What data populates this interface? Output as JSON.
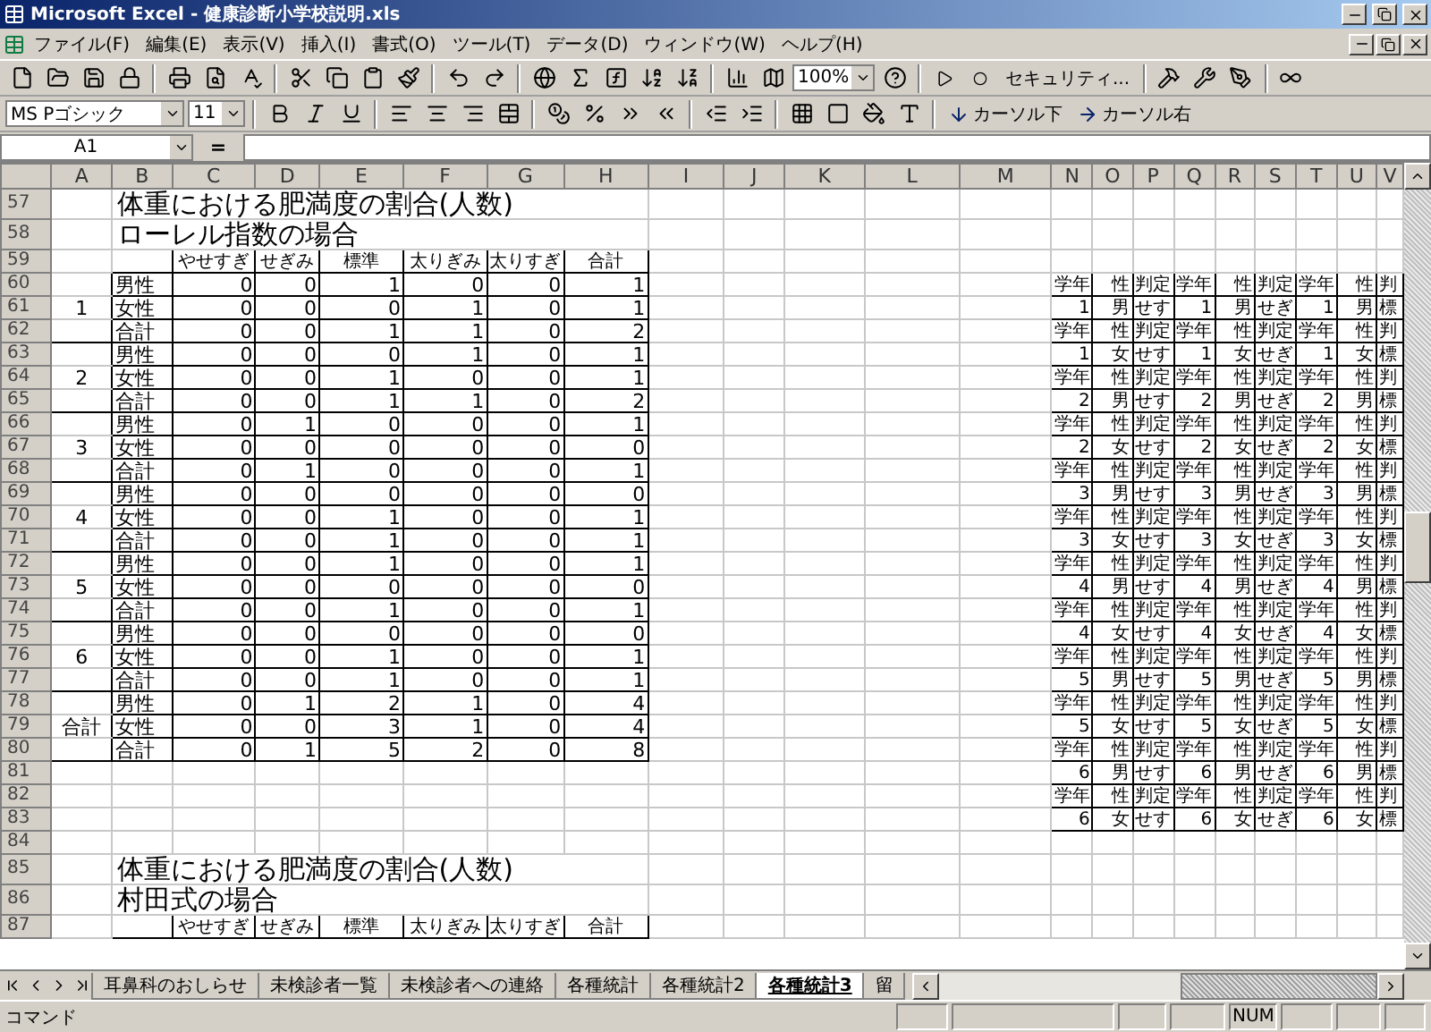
{
  "window": {
    "title": "Microsoft Excel - 健康診断小学校説明.xls"
  },
  "menu": [
    "ファイル(F)",
    "編集(E)",
    "表示(V)",
    "挿入(I)",
    "書式(O)",
    "ツール(T)",
    "データ(D)",
    "ウィンドウ(W)",
    "ヘルプ(H)"
  ],
  "toolbar": {
    "zoom": "100%",
    "security": "セキュリティ...",
    "font": "MS Pゴシック",
    "size": "11",
    "cursor_down": "カーソル下",
    "cursor_right": "カーソル右"
  },
  "formula_bar": {
    "name_box": "A1",
    "equals": "="
  },
  "columns": [
    "A",
    "B",
    "C",
    "D",
    "E",
    "F",
    "G",
    "H",
    "I",
    "J",
    "K",
    "L",
    "M",
    "N",
    "O",
    "P",
    "Q",
    "R",
    "S",
    "T",
    "U",
    "V"
  ],
  "rows": [
    {
      "num": "57",
      "kind": "title",
      "cells": {
        "B": "体重における肥満度の割合(人数)"
      }
    },
    {
      "num": "58",
      "kind": "title",
      "cells": {
        "B": "ローレル指数の場合"
      }
    },
    {
      "num": "59",
      "kind": "header",
      "cells": {
        "C": "やせすぎ",
        "D": "せぎみ",
        "E": "標準",
        "F": "太りぎみ",
        "G": "太りすぎ",
        "H": "合計"
      }
    },
    {
      "num": "60",
      "kind": "data",
      "cells": {
        "B": "男性",
        "C": "0",
        "D": "0",
        "E": "1",
        "F": "0",
        "G": "0",
        "H": "1",
        "N": "学年",
        "O": "性",
        "P": "判定",
        "Q": "学年",
        "R": "性",
        "S": "判定",
        "T": "学年",
        "U": "性",
        "V": "判"
      }
    },
    {
      "num": "61",
      "kind": "data",
      "cells": {
        "A": "1",
        "B": "女性",
        "C": "0",
        "D": "0",
        "E": "0",
        "F": "1",
        "G": "0",
        "H": "1",
        "N": "1",
        "O": "男",
        "P": "せす",
        "Q": "1",
        "R": "男",
        "S": "せぎ",
        "T": "1",
        "U": "男",
        "V": "標"
      }
    },
    {
      "num": "62",
      "kind": "data",
      "cells": {
        "B": "合計",
        "C": "0",
        "D": "0",
        "E": "1",
        "F": "1",
        "G": "0",
        "H": "2",
        "N": "学年",
        "O": "性",
        "P": "判定",
        "Q": "学年",
        "R": "性",
        "S": "判定",
        "T": "学年",
        "U": "性",
        "V": "判"
      }
    },
    {
      "num": "63",
      "kind": "data",
      "cells": {
        "B": "男性",
        "C": "0",
        "D": "0",
        "E": "0",
        "F": "1",
        "G": "0",
        "H": "1",
        "N": "1",
        "O": "女",
        "P": "せす",
        "Q": "1",
        "R": "女",
        "S": "せぎ",
        "T": "1",
        "U": "女",
        "V": "標"
      }
    },
    {
      "num": "64",
      "kind": "data",
      "cells": {
        "A": "2",
        "B": "女性",
        "C": "0",
        "D": "0",
        "E": "1",
        "F": "0",
        "G": "0",
        "H": "1",
        "N": "学年",
        "O": "性",
        "P": "判定",
        "Q": "学年",
        "R": "性",
        "S": "判定",
        "T": "学年",
        "U": "性",
        "V": "判"
      }
    },
    {
      "num": "65",
      "kind": "data",
      "cells": {
        "B": "合計",
        "C": "0",
        "D": "0",
        "E": "1",
        "F": "1",
        "G": "0",
        "H": "2",
        "N": "2",
        "O": "男",
        "P": "せす",
        "Q": "2",
        "R": "男",
        "S": "せぎ",
        "T": "2",
        "U": "男",
        "V": "標"
      }
    },
    {
      "num": "66",
      "kind": "data",
      "cells": {
        "B": "男性",
        "C": "0",
        "D": "1",
        "E": "0",
        "F": "0",
        "G": "0",
        "H": "1",
        "N": "学年",
        "O": "性",
        "P": "判定",
        "Q": "学年",
        "R": "性",
        "S": "判定",
        "T": "学年",
        "U": "性",
        "V": "判"
      }
    },
    {
      "num": "67",
      "kind": "data",
      "cells": {
        "A": "3",
        "B": "女性",
        "C": "0",
        "D": "0",
        "E": "0",
        "F": "0",
        "G": "0",
        "H": "0",
        "N": "2",
        "O": "女",
        "P": "せす",
        "Q": "2",
        "R": "女",
        "S": "せぎ",
        "T": "2",
        "U": "女",
        "V": "標"
      }
    },
    {
      "num": "68",
      "kind": "data",
      "cells": {
        "B": "合計",
        "C": "0",
        "D": "1",
        "E": "0",
        "F": "0",
        "G": "0",
        "H": "1",
        "N": "学年",
        "O": "性",
        "P": "判定",
        "Q": "学年",
        "R": "性",
        "S": "判定",
        "T": "学年",
        "U": "性",
        "V": "判"
      }
    },
    {
      "num": "69",
      "kind": "data",
      "cells": {
        "B": "男性",
        "C": "0",
        "D": "0",
        "E": "0",
        "F": "0",
        "G": "0",
        "H": "0",
        "N": "3",
        "O": "男",
        "P": "せす",
        "Q": "3",
        "R": "男",
        "S": "せぎ",
        "T": "3",
        "U": "男",
        "V": "標"
      }
    },
    {
      "num": "70",
      "kind": "data",
      "cells": {
        "A": "4",
        "B": "女性",
        "C": "0",
        "D": "0",
        "E": "1",
        "F": "0",
        "G": "0",
        "H": "1",
        "N": "学年",
        "O": "性",
        "P": "判定",
        "Q": "学年",
        "R": "性",
        "S": "判定",
        "T": "学年",
        "U": "性",
        "V": "判"
      }
    },
    {
      "num": "71",
      "kind": "data",
      "cells": {
        "B": "合計",
        "C": "0",
        "D": "0",
        "E": "1",
        "F": "0",
        "G": "0",
        "H": "1",
        "N": "3",
        "O": "女",
        "P": "せす",
        "Q": "3",
        "R": "女",
        "S": "せぎ",
        "T": "3",
        "U": "女",
        "V": "標"
      }
    },
    {
      "num": "72",
      "kind": "data",
      "cells": {
        "B": "男性",
        "C": "0",
        "D": "0",
        "E": "1",
        "F": "0",
        "G": "0",
        "H": "1",
        "N": "学年",
        "O": "性",
        "P": "判定",
        "Q": "学年",
        "R": "性",
        "S": "判定",
        "T": "学年",
        "U": "性",
        "V": "判"
      }
    },
    {
      "num": "73",
      "kind": "data",
      "cells": {
        "A": "5",
        "B": "女性",
        "C": "0",
        "D": "0",
        "E": "0",
        "F": "0",
        "G": "0",
        "H": "0",
        "N": "4",
        "O": "男",
        "P": "せす",
        "Q": "4",
        "R": "男",
        "S": "せぎ",
        "T": "4",
        "U": "男",
        "V": "標"
      }
    },
    {
      "num": "74",
      "kind": "data",
      "cells": {
        "B": "合計",
        "C": "0",
        "D": "0",
        "E": "1",
        "F": "0",
        "G": "0",
        "H": "1",
        "N": "学年",
        "O": "性",
        "P": "判定",
        "Q": "学年",
        "R": "性",
        "S": "判定",
        "T": "学年",
        "U": "性",
        "V": "判"
      }
    },
    {
      "num": "75",
      "kind": "data",
      "cells": {
        "B": "男性",
        "C": "0",
        "D": "0",
        "E": "0",
        "F": "0",
        "G": "0",
        "H": "0",
        "N": "4",
        "O": "女",
        "P": "せす",
        "Q": "4",
        "R": "女",
        "S": "せぎ",
        "T": "4",
        "U": "女",
        "V": "標"
      }
    },
    {
      "num": "76",
      "kind": "data",
      "cells": {
        "A": "6",
        "B": "女性",
        "C": "0",
        "D": "0",
        "E": "1",
        "F": "0",
        "G": "0",
        "H": "1",
        "N": "学年",
        "O": "性",
        "P": "判定",
        "Q": "学年",
        "R": "性",
        "S": "判定",
        "T": "学年",
        "U": "性",
        "V": "判"
      }
    },
    {
      "num": "77",
      "kind": "data",
      "cells": {
        "B": "合計",
        "C": "0",
        "D": "0",
        "E": "1",
        "F": "0",
        "G": "0",
        "H": "1",
        "N": "5",
        "O": "男",
        "P": "せす",
        "Q": "5",
        "R": "男",
        "S": "せぎ",
        "T": "5",
        "U": "男",
        "V": "標"
      }
    },
    {
      "num": "78",
      "kind": "data",
      "cells": {
        "B": "男性",
        "C": "0",
        "D": "1",
        "E": "2",
        "F": "1",
        "G": "0",
        "H": "4",
        "N": "学年",
        "O": "性",
        "P": "判定",
        "Q": "学年",
        "R": "性",
        "S": "判定",
        "T": "学年",
        "U": "性",
        "V": "判"
      }
    },
    {
      "num": "79",
      "kind": "data",
      "cells": {
        "A": "合計",
        "B": "女性",
        "C": "0",
        "D": "0",
        "E": "3",
        "F": "1",
        "G": "0",
        "H": "4",
        "N": "5",
        "O": "女",
        "P": "せす",
        "Q": "5",
        "R": "女",
        "S": "せぎ",
        "T": "5",
        "U": "女",
        "V": "標"
      }
    },
    {
      "num": "80",
      "kind": "data",
      "cells": {
        "B": "合計",
        "C": "0",
        "D": "1",
        "E": "5",
        "F": "2",
        "G": "0",
        "H": "8",
        "N": "学年",
        "O": "性",
        "P": "判定",
        "Q": "学年",
        "R": "性",
        "S": "判定",
        "T": "学年",
        "U": "性",
        "V": "判"
      }
    },
    {
      "num": "81",
      "kind": "blank",
      "cells": {
        "N": "6",
        "O": "男",
        "P": "せす",
        "Q": "6",
        "R": "男",
        "S": "せぎ",
        "T": "6",
        "U": "男",
        "V": "標"
      }
    },
    {
      "num": "82",
      "kind": "blank",
      "cells": {
        "N": "学年",
        "O": "性",
        "P": "判定",
        "Q": "学年",
        "R": "性",
        "S": "判定",
        "T": "学年",
        "U": "性",
        "V": "判"
      }
    },
    {
      "num": "83",
      "kind": "blank",
      "cells": {
        "N": "6",
        "O": "女",
        "P": "せす",
        "Q": "6",
        "R": "女",
        "S": "せぎ",
        "T": "6",
        "U": "女",
        "V": "標"
      }
    },
    {
      "num": "84",
      "kind": "blank",
      "cells": {}
    },
    {
      "num": "85",
      "kind": "title",
      "cells": {
        "B": "体重における肥満度の割合(人数)"
      }
    },
    {
      "num": "86",
      "kind": "title",
      "cells": {
        "B": "村田式の場合"
      }
    },
    {
      "num": "87",
      "kind": "header",
      "cells": {
        "C": "やせすぎ",
        "D": "せぎみ",
        "E": "標準",
        "F": "太りぎみ",
        "G": "太りすぎ",
        "H": "合計"
      }
    }
  ],
  "sheets": [
    {
      "label": "耳鼻科のおしらせ",
      "selected": false
    },
    {
      "label": "未検診者一覧",
      "selected": false
    },
    {
      "label": "未検診者への連絡",
      "selected": false
    },
    {
      "label": "各種統計",
      "selected": false
    },
    {
      "label": "各種統計2",
      "selected": false
    },
    {
      "label": "各種統計3",
      "selected": true
    },
    {
      "label": "留",
      "selected": false
    }
  ],
  "status_bar": {
    "mode": "コマンド",
    "num": "NUM"
  }
}
